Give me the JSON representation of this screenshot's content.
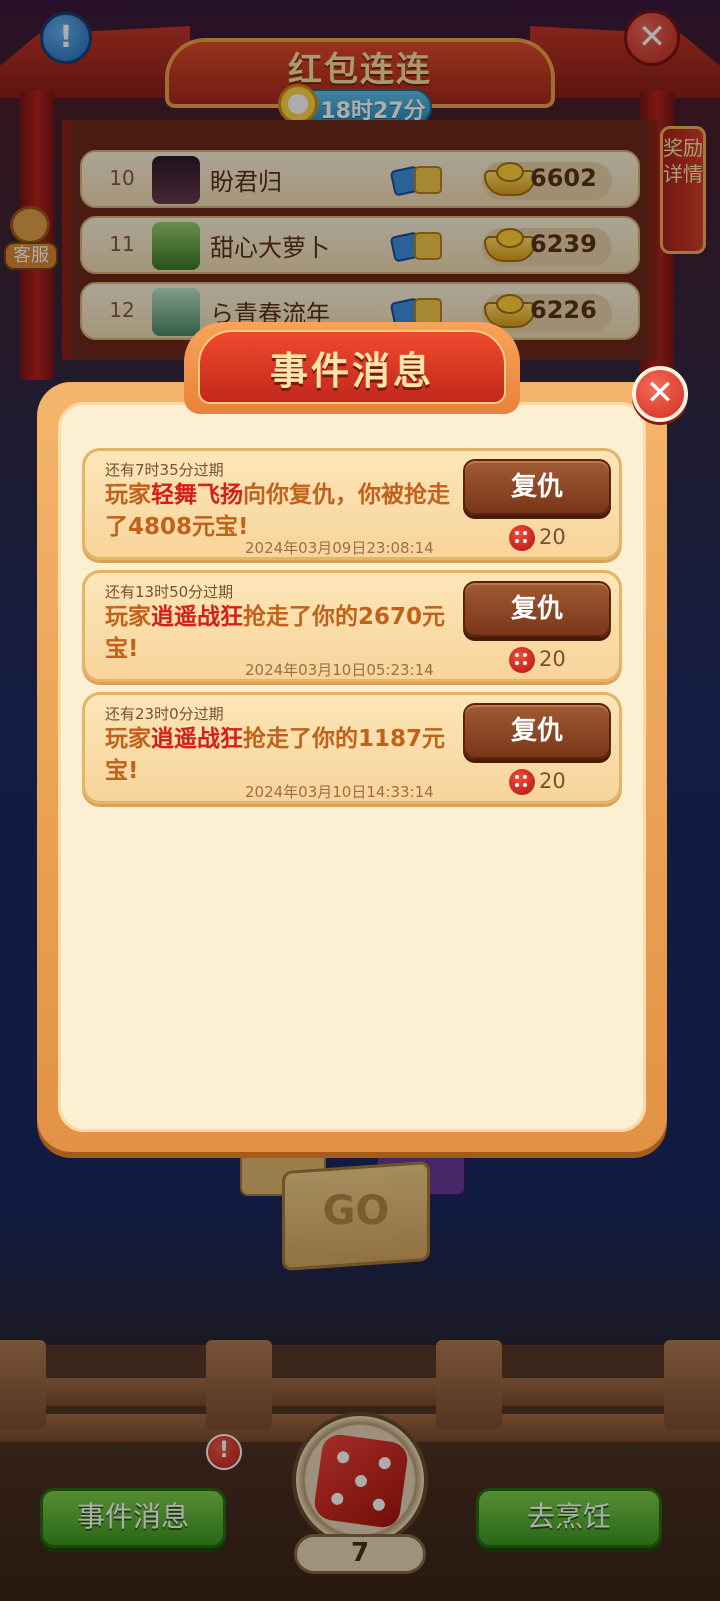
{
  "game": {
    "board_title": "红包连连",
    "timer": "18时27分",
    "reward_tab": "奖励详情",
    "customer_service": "客服"
  },
  "leaderboard": [
    {
      "rank": "10",
      "name": "盼君归",
      "gold": "6602"
    },
    {
      "rank": "11",
      "name": "甜心大萝卜",
      "gold": "6239"
    },
    {
      "rank": "12",
      "name": "ら青春流年",
      "gold": "6226"
    }
  ],
  "modal": {
    "title": "事件消息",
    "events": [
      {
        "expire": "还有7时35分过期",
        "prefix": "玩家",
        "player": "轻舞飞扬",
        "suffix": "向你复仇，你被抢走了4808元宝!",
        "time": "2024年03月09日23:08:14",
        "button": "复仇",
        "cost": "20"
      },
      {
        "expire": "还有13时50分过期",
        "prefix": "玩家",
        "player": "逍遥战狂",
        "suffix": "抢走了你的2670元宝!",
        "time": "2024年03月10日05:23:14",
        "button": "复仇",
        "cost": "20"
      },
      {
        "expire": "还有23时0分过期",
        "prefix": "玩家",
        "player": "逍遥战狂",
        "suffix": "抢走了你的1187元宝!",
        "time": "2024年03月10日14:33:14",
        "button": "复仇",
        "cost": "20"
      }
    ]
  },
  "board": {
    "go_label": "GO"
  },
  "bottom": {
    "left_button": "事件消息",
    "right_button": "去烹饪",
    "dice_count": "7",
    "alert": "!"
  },
  "colors": {
    "modal_border": "#e29244",
    "modal_fill": "#fcefd2",
    "player_name": "#d42018",
    "message_text": "#c0621c",
    "revenge_button": "#7a3618",
    "green_button": "#3f9a22"
  }
}
